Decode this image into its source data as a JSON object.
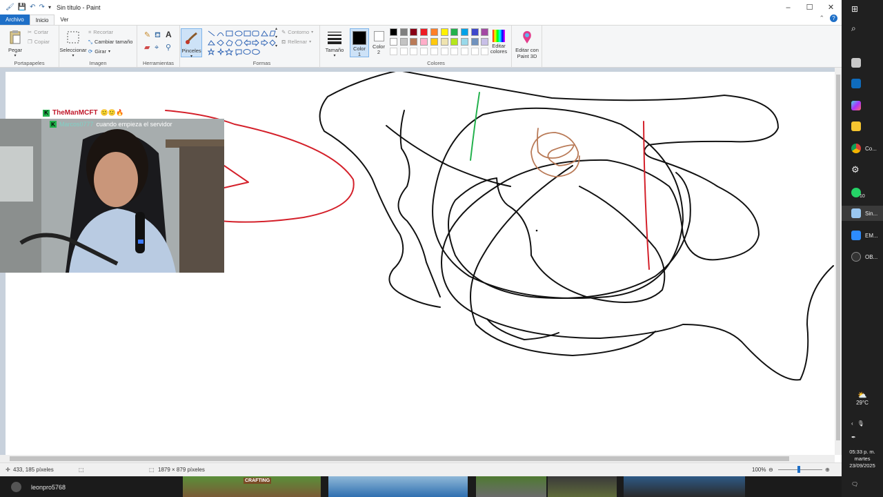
{
  "window": {
    "title": "Sin título - Paint"
  },
  "tabs": {
    "file": "Archivo",
    "home": "Inicio",
    "view": "Ver"
  },
  "ribbon": {
    "clipboard": {
      "paste": "Pegar",
      "cut": "Cortar",
      "copy": "Copiar",
      "label": "Portapapeles"
    },
    "image": {
      "select": "Seleccionar",
      "crop": "Recortar",
      "resize": "Cambiar tamaño",
      "rotate": "Girar",
      "label": "Imagen"
    },
    "tools": {
      "label": "Herramientas"
    },
    "brushes": {
      "label": "Pinceles"
    },
    "shapes": {
      "outline": "Contorno",
      "fill": "Rellenar",
      "label": "Formas"
    },
    "size": {
      "label": "Tamaño"
    },
    "color1": {
      "label1": "Color",
      "label2": "1"
    },
    "color2": {
      "label1": "Color",
      "label2": "2"
    },
    "colors": {
      "label": "Colores",
      "edit1": "Editar",
      "edit2": "colores",
      "paint3d1": "Editar con",
      "paint3d2": "Paint 3D"
    },
    "palette_row1": [
      "#000000",
      "#7f7f7f",
      "#880015",
      "#ed1c24",
      "#ff7f27",
      "#fff200",
      "#22b14c",
      "#00a2e8",
      "#3f48cc",
      "#a349a4"
    ],
    "palette_row2": [
      "#ffffff",
      "#c3c3c3",
      "#b97a57",
      "#ffaec9",
      "#ffc90e",
      "#efe4b0",
      "#b5e61d",
      "#99d9ea",
      "#7092be",
      "#c8bfe7"
    ],
    "selected_color1": "#000000",
    "selected_color2": "#ffffff"
  },
  "status": {
    "cursor": "433, 185 píxeles",
    "dimensions": "1879 × 879 píxeles",
    "zoom": "100%"
  },
  "overlay": {
    "chat_user1": "TheManMCFT",
    "chat_user2": "Marcos0777",
    "chat_message": "cuando empieza el servidor"
  },
  "taskbar": {
    "username": "leonpro5768",
    "thumb_label": "CRAFTING"
  },
  "system": {
    "apps": [
      {
        "label": "Co..."
      },
      {
        "label": "10"
      },
      {
        "label": "Sin..."
      },
      {
        "label": "EM..."
      },
      {
        "label": "OB..."
      }
    ],
    "temperature": "29°C",
    "time": "05:33 p. m.",
    "day": "martes",
    "date": "23/09/2025"
  }
}
